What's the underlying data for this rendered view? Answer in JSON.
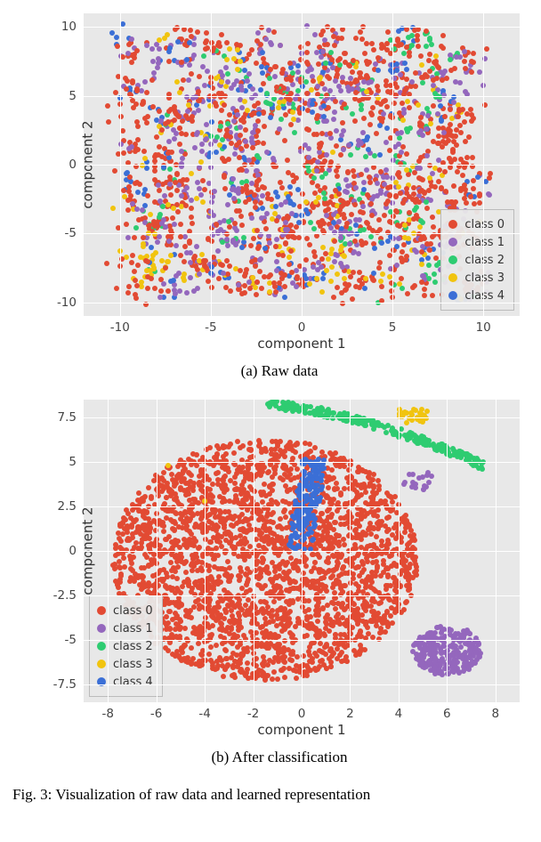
{
  "caption_a": "(a) Raw data",
  "caption_b": "(b) After classification",
  "figure_caption": "Fig. 3: Visualization of raw data and learned representation",
  "axis": {
    "xlabel": "component 1",
    "ylabel": "component 2"
  },
  "legend": {
    "items": [
      {
        "label": "class 0",
        "color": "#e24a33"
      },
      {
        "label": "class 1",
        "color": "#9467bd"
      },
      {
        "label": "class 2",
        "color": "#2ecc71"
      },
      {
        "label": "class 3",
        "color": "#f1c40f"
      },
      {
        "label": "class 4",
        "color": "#3b6fd6"
      }
    ]
  },
  "chart_data": [
    {
      "id": "raw",
      "type": "scatter",
      "title": "Raw data",
      "xlabel": "component 1",
      "ylabel": "component 2",
      "xlim": [
        -12,
        12
      ],
      "ylim": [
        -11,
        11
      ],
      "xticks": [
        -10,
        -5,
        0,
        5,
        10
      ],
      "yticks": [
        -10,
        -5,
        0,
        5,
        10
      ],
      "legend_position": "lower right",
      "series": [
        {
          "name": "class 0",
          "color": "#e24a33",
          "distribution": "highly mixed, dominant across full plane"
        },
        {
          "name": "class 1",
          "color": "#9467bd",
          "distribution": "mixed throughout, roughly second-most frequent"
        },
        {
          "name": "class 2",
          "color": "#2ecc71",
          "distribution": "scattered sparse clusters"
        },
        {
          "name": "class 3",
          "color": "#f1c40f",
          "distribution": "scattered sparse clusters"
        },
        {
          "name": "class 4",
          "color": "#3b6fd6",
          "distribution": "scattered sparse clusters, some along top edge"
        }
      ],
      "note": "t-SNE-style 2-D embedding; five classes heavily intermixed; no clean separation"
    },
    {
      "id": "after",
      "type": "scatter",
      "title": "After classification",
      "xlabel": "component 1",
      "ylabel": "component 2",
      "xlim": [
        -9,
        9
      ],
      "ylim": [
        -8.5,
        8.5
      ],
      "xticks": [
        -8,
        -6,
        -4,
        -2,
        0,
        2,
        4,
        6,
        8
      ],
      "yticks": [
        -7.5,
        -5.0,
        -2.5,
        0.0,
        2.5,
        5.0,
        7.5
      ],
      "legend_position": "lower left",
      "series": [
        {
          "name": "class 0",
          "color": "#e24a33",
          "region": "large dense blob covering roughly x∈[-8,5], y∈[-7.5,6.5]"
        },
        {
          "name": "class 1",
          "color": "#9467bd",
          "region": "compact cluster around x≈6, y≈-5.5, plus few points near x≈5, y≈4"
        },
        {
          "name": "class 2",
          "color": "#2ecc71",
          "region": "arc along top, from (-1,8) curving to (7.5,5)"
        },
        {
          "name": "class 3",
          "color": "#f1c40f",
          "region": "tiny cluster near x≈5, y≈7.7 and a few stray dots"
        },
        {
          "name": "class 4",
          "color": "#3b6fd6",
          "region": "elongated vertical streak near x≈0.5, y∈[0,5]"
        }
      ],
      "note": "learned representation separates classes into distinct regions"
    }
  ]
}
